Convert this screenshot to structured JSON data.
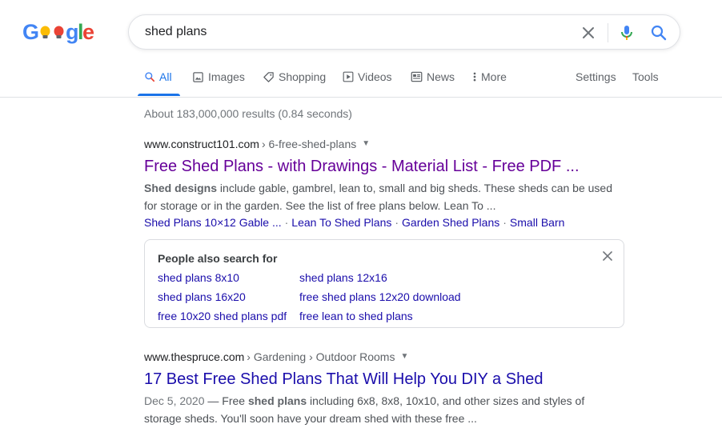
{
  "logo": {
    "text": "Google",
    "letters": [
      "G",
      "o",
      "o",
      "g",
      "l",
      "e"
    ]
  },
  "search": {
    "query": "shed plans",
    "placeholder": ""
  },
  "icons": {
    "clear": "close-icon",
    "voice": "mic-icon",
    "search": "search-icon"
  },
  "colors": {
    "accent": "#1a73e8",
    "link": "#1a0dab",
    "visited": "#660099",
    "snippet": "#4d5156"
  },
  "tabs": [
    {
      "label": "All",
      "icon": "search-icon",
      "active": true
    },
    {
      "label": "Images",
      "icon": "image-icon"
    },
    {
      "label": "Shopping",
      "icon": "tag-icon"
    },
    {
      "label": "Videos",
      "icon": "play-icon"
    },
    {
      "label": "News",
      "icon": "newspaper-icon"
    },
    {
      "label": "More",
      "icon": "more-vert-icon"
    }
  ],
  "tools": {
    "settings": "Settings",
    "tools": "Tools"
  },
  "stats": "About 183,000,000 results (0.84 seconds)",
  "results": [
    {
      "domain": "www.construct101.com",
      "path": "› 6-free-shed-plans",
      "title": "Free Shed Plans - with Drawings - Material List - Free PDF ...",
      "snippet_bold": "Shed designs",
      "snippet_rest": " include gable, gambrel, lean to, small and big sheds. These sheds can be used for storage or in the garden. See the list of free plans below. Lean To ...",
      "sitelinks": [
        "Shed Plans 10×12 Gable ...",
        "Lean To Shed Plans",
        "Garden Shed Plans",
        "Small Barn"
      ]
    },
    {
      "domain": "www.thespruce.com",
      "path": "› Gardening › Outdoor Rooms",
      "title": "17 Best Free Shed Plans That Will Help You DIY a Shed",
      "date": "Dec 5, 2020",
      "snippet_pre": " — Free ",
      "snippet_bold": "shed plans",
      "snippet_rest": " including 6x8, 8x8, 10x10, and other sizes and styles of storage sheds. You'll soon have your dream shed with these free ..."
    }
  ],
  "people_also_search": {
    "title": "People also search for",
    "left": [
      "shed plans 8x10",
      "shed plans 16x20",
      "free 10x20 shed plans pdf"
    ],
    "right": [
      "shed plans 12x16",
      "free shed plans 12x20 download",
      "free lean to shed plans"
    ]
  }
}
